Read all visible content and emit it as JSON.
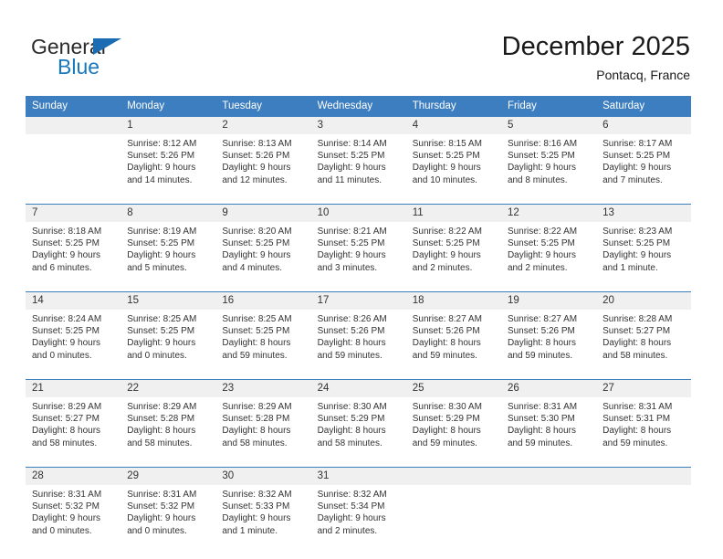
{
  "brand": {
    "name_primary": "General",
    "name_secondary": "Blue",
    "accent_color": "#1878be",
    "triangle_color": "#1c6cb4"
  },
  "header": {
    "title": "December 2025",
    "subtitle": "Pontacq, France"
  },
  "theme": {
    "header_bar_color": "#3c7ebf",
    "day_number_band_color": "#f0f0f0",
    "cell_background": "#ffffff",
    "text_color": "#333333"
  },
  "weekdays": [
    "Sunday",
    "Monday",
    "Tuesday",
    "Wednesday",
    "Thursday",
    "Friday",
    "Saturday"
  ],
  "weeks": [
    {
      "days": [
        {
          "num": "",
          "sunrise": "",
          "sunset": "",
          "daylight1": "",
          "daylight2": ""
        },
        {
          "num": "1",
          "sunrise": "Sunrise: 8:12 AM",
          "sunset": "Sunset: 5:26 PM",
          "daylight1": "Daylight: 9 hours",
          "daylight2": "and 14 minutes."
        },
        {
          "num": "2",
          "sunrise": "Sunrise: 8:13 AM",
          "sunset": "Sunset: 5:26 PM",
          "daylight1": "Daylight: 9 hours",
          "daylight2": "and 12 minutes."
        },
        {
          "num": "3",
          "sunrise": "Sunrise: 8:14 AM",
          "sunset": "Sunset: 5:25 PM",
          "daylight1": "Daylight: 9 hours",
          "daylight2": "and 11 minutes."
        },
        {
          "num": "4",
          "sunrise": "Sunrise: 8:15 AM",
          "sunset": "Sunset: 5:25 PM",
          "daylight1": "Daylight: 9 hours",
          "daylight2": "and 10 minutes."
        },
        {
          "num": "5",
          "sunrise": "Sunrise: 8:16 AM",
          "sunset": "Sunset: 5:25 PM",
          "daylight1": "Daylight: 9 hours",
          "daylight2": "and 8 minutes."
        },
        {
          "num": "6",
          "sunrise": "Sunrise: 8:17 AM",
          "sunset": "Sunset: 5:25 PM",
          "daylight1": "Daylight: 9 hours",
          "daylight2": "and 7 minutes."
        }
      ]
    },
    {
      "days": [
        {
          "num": "7",
          "sunrise": "Sunrise: 8:18 AM",
          "sunset": "Sunset: 5:25 PM",
          "daylight1": "Daylight: 9 hours",
          "daylight2": "and 6 minutes."
        },
        {
          "num": "8",
          "sunrise": "Sunrise: 8:19 AM",
          "sunset": "Sunset: 5:25 PM",
          "daylight1": "Daylight: 9 hours",
          "daylight2": "and 5 minutes."
        },
        {
          "num": "9",
          "sunrise": "Sunrise: 8:20 AM",
          "sunset": "Sunset: 5:25 PM",
          "daylight1": "Daylight: 9 hours",
          "daylight2": "and 4 minutes."
        },
        {
          "num": "10",
          "sunrise": "Sunrise: 8:21 AM",
          "sunset": "Sunset: 5:25 PM",
          "daylight1": "Daylight: 9 hours",
          "daylight2": "and 3 minutes."
        },
        {
          "num": "11",
          "sunrise": "Sunrise: 8:22 AM",
          "sunset": "Sunset: 5:25 PM",
          "daylight1": "Daylight: 9 hours",
          "daylight2": "and 2 minutes."
        },
        {
          "num": "12",
          "sunrise": "Sunrise: 8:22 AM",
          "sunset": "Sunset: 5:25 PM",
          "daylight1": "Daylight: 9 hours",
          "daylight2": "and 2 minutes."
        },
        {
          "num": "13",
          "sunrise": "Sunrise: 8:23 AM",
          "sunset": "Sunset: 5:25 PM",
          "daylight1": "Daylight: 9 hours",
          "daylight2": "and 1 minute."
        }
      ]
    },
    {
      "days": [
        {
          "num": "14",
          "sunrise": "Sunrise: 8:24 AM",
          "sunset": "Sunset: 5:25 PM",
          "daylight1": "Daylight: 9 hours",
          "daylight2": "and 0 minutes."
        },
        {
          "num": "15",
          "sunrise": "Sunrise: 8:25 AM",
          "sunset": "Sunset: 5:25 PM",
          "daylight1": "Daylight: 9 hours",
          "daylight2": "and 0 minutes."
        },
        {
          "num": "16",
          "sunrise": "Sunrise: 8:25 AM",
          "sunset": "Sunset: 5:25 PM",
          "daylight1": "Daylight: 8 hours",
          "daylight2": "and 59 minutes."
        },
        {
          "num": "17",
          "sunrise": "Sunrise: 8:26 AM",
          "sunset": "Sunset: 5:26 PM",
          "daylight1": "Daylight: 8 hours",
          "daylight2": "and 59 minutes."
        },
        {
          "num": "18",
          "sunrise": "Sunrise: 8:27 AM",
          "sunset": "Sunset: 5:26 PM",
          "daylight1": "Daylight: 8 hours",
          "daylight2": "and 59 minutes."
        },
        {
          "num": "19",
          "sunrise": "Sunrise: 8:27 AM",
          "sunset": "Sunset: 5:26 PM",
          "daylight1": "Daylight: 8 hours",
          "daylight2": "and 59 minutes."
        },
        {
          "num": "20",
          "sunrise": "Sunrise: 8:28 AM",
          "sunset": "Sunset: 5:27 PM",
          "daylight1": "Daylight: 8 hours",
          "daylight2": "and 58 minutes."
        }
      ]
    },
    {
      "days": [
        {
          "num": "21",
          "sunrise": "Sunrise: 8:29 AM",
          "sunset": "Sunset: 5:27 PM",
          "daylight1": "Daylight: 8 hours",
          "daylight2": "and 58 minutes."
        },
        {
          "num": "22",
          "sunrise": "Sunrise: 8:29 AM",
          "sunset": "Sunset: 5:28 PM",
          "daylight1": "Daylight: 8 hours",
          "daylight2": "and 58 minutes."
        },
        {
          "num": "23",
          "sunrise": "Sunrise: 8:29 AM",
          "sunset": "Sunset: 5:28 PM",
          "daylight1": "Daylight: 8 hours",
          "daylight2": "and 58 minutes."
        },
        {
          "num": "24",
          "sunrise": "Sunrise: 8:30 AM",
          "sunset": "Sunset: 5:29 PM",
          "daylight1": "Daylight: 8 hours",
          "daylight2": "and 58 minutes."
        },
        {
          "num": "25",
          "sunrise": "Sunrise: 8:30 AM",
          "sunset": "Sunset: 5:29 PM",
          "daylight1": "Daylight: 8 hours",
          "daylight2": "and 59 minutes."
        },
        {
          "num": "26",
          "sunrise": "Sunrise: 8:31 AM",
          "sunset": "Sunset: 5:30 PM",
          "daylight1": "Daylight: 8 hours",
          "daylight2": "and 59 minutes."
        },
        {
          "num": "27",
          "sunrise": "Sunrise: 8:31 AM",
          "sunset": "Sunset: 5:31 PM",
          "daylight1": "Daylight: 8 hours",
          "daylight2": "and 59 minutes."
        }
      ]
    },
    {
      "days": [
        {
          "num": "28",
          "sunrise": "Sunrise: 8:31 AM",
          "sunset": "Sunset: 5:32 PM",
          "daylight1": "Daylight: 9 hours",
          "daylight2": "and 0 minutes."
        },
        {
          "num": "29",
          "sunrise": "Sunrise: 8:31 AM",
          "sunset": "Sunset: 5:32 PM",
          "daylight1": "Daylight: 9 hours",
          "daylight2": "and 0 minutes."
        },
        {
          "num": "30",
          "sunrise": "Sunrise: 8:32 AM",
          "sunset": "Sunset: 5:33 PM",
          "daylight1": "Daylight: 9 hours",
          "daylight2": "and 1 minute."
        },
        {
          "num": "31",
          "sunrise": "Sunrise: 8:32 AM",
          "sunset": "Sunset: 5:34 PM",
          "daylight1": "Daylight: 9 hours",
          "daylight2": "and 2 minutes."
        },
        {
          "num": "",
          "sunrise": "",
          "sunset": "",
          "daylight1": "",
          "daylight2": ""
        },
        {
          "num": "",
          "sunrise": "",
          "sunset": "",
          "daylight1": "",
          "daylight2": ""
        },
        {
          "num": "",
          "sunrise": "",
          "sunset": "",
          "daylight1": "",
          "daylight2": ""
        }
      ]
    }
  ]
}
